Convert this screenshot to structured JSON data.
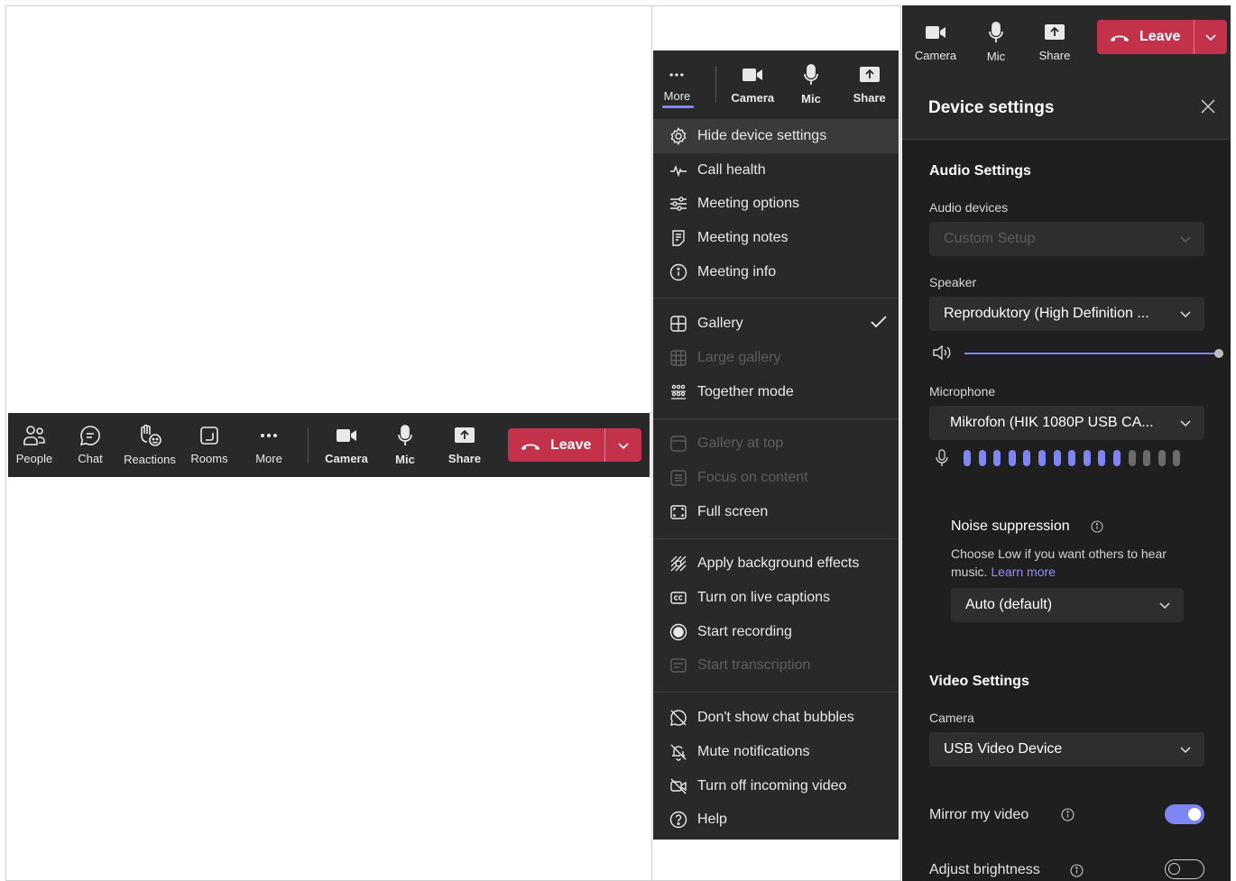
{
  "toolbar_full": {
    "items": [
      {
        "label": "People",
        "icon": "people-icon"
      },
      {
        "label": "Chat",
        "icon": "chat-icon"
      },
      {
        "label": "Reactions",
        "icon": "reactions-icon"
      },
      {
        "label": "Rooms",
        "icon": "rooms-icon"
      },
      {
        "label": "More",
        "icon": "more-icon"
      }
    ],
    "camera_label": "Camera",
    "mic_label": "Mic",
    "share_label": "Share",
    "leave_label": "Leave"
  },
  "more_menu": {
    "toolbar": {
      "more_label": "More",
      "camera_label": "Camera",
      "mic_label": "Mic",
      "share_label": "Share"
    },
    "items": [
      {
        "label": "Hide device settings",
        "icon": "gear-icon",
        "state": "selected"
      },
      {
        "label": "Call health",
        "icon": "pulse-icon",
        "state": "enabled"
      },
      {
        "label": "Meeting options",
        "icon": "sliders-icon",
        "state": "enabled"
      },
      {
        "label": "Meeting notes",
        "icon": "notes-icon",
        "state": "enabled"
      },
      {
        "label": "Meeting info",
        "icon": "info-icon",
        "state": "enabled"
      },
      {
        "label": "Gallery",
        "icon": "gallery-icon",
        "state": "checked"
      },
      {
        "label": "Large gallery",
        "icon": "large-gallery-icon",
        "state": "disabled"
      },
      {
        "label": "Together mode",
        "icon": "together-mode-icon",
        "state": "enabled"
      },
      {
        "label": "Gallery at top",
        "icon": "gallery-top-icon",
        "state": "disabled"
      },
      {
        "label": "Focus on content",
        "icon": "focus-icon",
        "state": "disabled"
      },
      {
        "label": "Full screen",
        "icon": "fullscreen-icon",
        "state": "enabled"
      },
      {
        "label": "Apply background effects",
        "icon": "background-effects-icon",
        "state": "enabled"
      },
      {
        "label": "Turn on live captions",
        "icon": "captions-icon",
        "state": "enabled"
      },
      {
        "label": "Start recording",
        "icon": "record-icon",
        "state": "enabled"
      },
      {
        "label": "Start transcription",
        "icon": "transcription-icon",
        "state": "disabled"
      },
      {
        "label": "Don't show chat bubbles",
        "icon": "chat-bubbles-off-icon",
        "state": "enabled"
      },
      {
        "label": "Mute notifications",
        "icon": "bell-off-icon",
        "state": "enabled"
      },
      {
        "label": "Turn off incoming video",
        "icon": "video-off-icon",
        "state": "enabled"
      },
      {
        "label": "Help",
        "icon": "help-icon",
        "state": "enabled"
      }
    ]
  },
  "device_settings": {
    "toolbar": {
      "camera_label": "Camera",
      "mic_label": "Mic",
      "share_label": "Share",
      "leave_label": "Leave"
    },
    "title": "Device settings",
    "audio_section": "Audio Settings",
    "audio_devices_label": "Audio devices",
    "audio_devices_value": "Custom Setup",
    "speaker_label": "Speaker",
    "speaker_value": "Reproduktory (High Definition ...",
    "speaker_volume": 1.0,
    "microphone_label": "Microphone",
    "microphone_value": "Mikrofon (HIK 1080P USB CA...",
    "mic_level": {
      "active": 11,
      "total": 15
    },
    "noise_label": "Noise suppression",
    "noise_desc": "Choose Low if you want others to hear music.",
    "noise_link": "Learn more",
    "noise_value": "Auto (default)",
    "video_section": "Video Settings",
    "camera_label": "Camera",
    "camera_value": "USB Video Device",
    "mirror_label": "Mirror my video",
    "mirror_on": true,
    "brightness_label": "Adjust brightness",
    "brightness_on": false,
    "accent_color": "#7f85f5",
    "leave_color": "#c4314b"
  }
}
